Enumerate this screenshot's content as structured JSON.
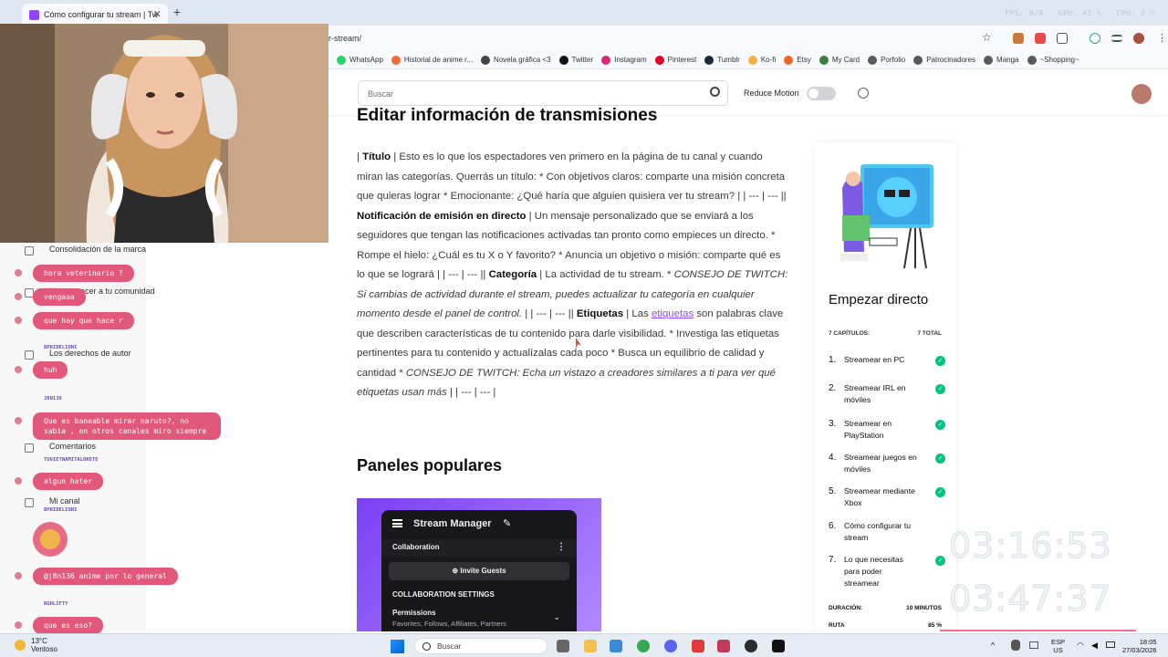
{
  "browser": {
    "tab_title": "Cómo configurar tu stream | Tw",
    "url_fragment": "r-stream/",
    "perf": {
      "fps_label": "FPS",
      "fps_value": "N/A",
      "gpu_label": "GPU",
      "gpu_value": "41 %",
      "cpu_label": "CPU",
      "cpu_value": "2 %"
    },
    "bookmarks": [
      {
        "label": "WhatsApp",
        "color": "#25d366"
      },
      {
        "label": "Historial de anime r...",
        "color": "#f26b3a"
      },
      {
        "label": "Novela gráfica <3",
        "color": "#444444"
      },
      {
        "label": "Twitter",
        "color": "#111111"
      },
      {
        "label": "Instagram",
        "color": "#d62976"
      },
      {
        "label": "Pinterest",
        "color": "#e60023"
      },
      {
        "label": "Tumblr",
        "color": "#1a2a3a"
      },
      {
        "label": "Ko-fi",
        "color": "#f5b041"
      },
      {
        "label": "Etsy",
        "color": "#f1641e"
      },
      {
        "label": "My Card",
        "color": "#3d7b3d"
      },
      {
        "label": "Porfolio",
        "color": "#5a5a5a"
      },
      {
        "label": "Patrocinadores",
        "color": "#5a5a5a"
      },
      {
        "label": "Manga",
        "color": "#5a5a5a"
      },
      {
        "label": "~Shopping~",
        "color": "#5a5a5a"
      }
    ]
  },
  "site": {
    "search_placeholder": "Buscar",
    "reduce_motion": "Reduce Motion",
    "reduce_motion_on": false
  },
  "article": {
    "heading": "Editar información de transmisiones",
    "p": {
      "a1": "| ",
      "b1": "Título",
      "a2": " | Esto es lo que los espectadores ven primero en la página de tu canal y cuando miran las categorías. Querrás un título: * Con objetivos claros: comparte una misión concreta que quieras lograr * Emocionante: ¿Qué haría que alguien quisiera ver tu stream? | | --- | --- || ",
      "b2": "Notificación de emisión en directo",
      "a3": " | Un mensaje personalizado que se enviará a los seguidores que tengan las notificaciones activadas tan pronto como empieces un directo. * Rompe el hielo: ¿Cuál es tu X o Y favorito? * Anuncia un objetivo o misión: comparte qué es lo que se logrará | | --- | --- || ",
      "b3": "Categoría",
      "a4": " | La actividad de tu stream. * ",
      "i1": "CONSEJO DE TWITCH: Si cambias de actividad durante el stream, puedes actualizar tu categoría en cualquier momento desde el panel de control.",
      "a5": " | | --- | --- || ",
      "b4": "Etiquetas",
      "a6": " | Las ",
      "link": "etiquetas",
      "a7": " son palabras clave que describen características de tu contenido para darle visibilidad. * Investiga las etiquetas pertinentes para tu contenido y actualízalas cada poco * Busca un equilibrio de calidad y cantidad * ",
      "i2": "CONSEJO DE TWITCH: Echa un vistazo a creadores similares a ti para ver qué etiquetas usan más",
      "a8": " | | --- | --- |"
    },
    "panels_heading": "Paneles populares",
    "stream_manager": {
      "title": "Stream Manager",
      "collaboration": "Collaboration",
      "invite": "Invite Guests",
      "settings": "COLLABORATION SETTINGS",
      "permissions": "Permissions",
      "permissions_sub": "Favorites, Follows, Affiliates, Partners"
    }
  },
  "card": {
    "title": "Empezar directo",
    "chapters_label": "7 CAPÍTULOS:",
    "total_label": "7 TOTAL",
    "chapters": [
      {
        "n": "1.",
        "label": "Streamear en PC",
        "done": true
      },
      {
        "n": "2.",
        "label": "Streamear IRL en móviles",
        "done": true
      },
      {
        "n": "3.",
        "label": "Streamear en PlayStation",
        "done": true
      },
      {
        "n": "4.",
        "label": "Streamear juegos en móviles",
        "done": true
      },
      {
        "n": "5.",
        "label": "Streamear mediante Xbox",
        "done": true
      },
      {
        "n": "6.",
        "label": "Cómo configurar tu stream",
        "done": false
      },
      {
        "n": "7.",
        "label": "Lo que necesitas para poder streamear",
        "done": true
      }
    ],
    "duration_label": "DURACIÓN:",
    "duration_value": "10 MINUTOS",
    "route_label": "RUTA",
    "route_value": "85 %"
  },
  "overlay": {
    "timer1": "03:16:53",
    "timer2": "03:47:37"
  },
  "left_menu": [
    {
      "label": "Consolidación de la marca"
    },
    {
      "label": "Hacer crecer a tu comunidad"
    },
    {
      "label": "Los derechos de autor"
    },
    {
      "label": "Comentarios"
    },
    {
      "label": "Mi canal"
    }
  ],
  "chat": [
    {
      "text": "hora veterinario ?",
      "user": ""
    },
    {
      "text": "vengaaa",
      "user": ""
    },
    {
      "text": "que hay que hace r",
      "user": "DPRIDELIONI"
    },
    {
      "text": "huh",
      "user": "J8N136"
    },
    {
      "text": "Que es baneable mirar naruto?, no sabia , en otros canales miro siempre",
      "user": "TUVIETNAMITALOKETE"
    },
    {
      "text": "algun hater",
      "user": "DPRIDELIONI"
    },
    {
      "text": "@j8n136 anime por lo general",
      "user": "RGHLIFTY"
    },
    {
      "text": "que es eso?",
      "user": ""
    }
  ],
  "taskbar": {
    "weather_temp": "13°C",
    "weather_desc": "Ventoso",
    "search": "Buscar",
    "lang1": "ESP",
    "lang2": "US",
    "time": "18:05",
    "date": "27/03/2026"
  }
}
